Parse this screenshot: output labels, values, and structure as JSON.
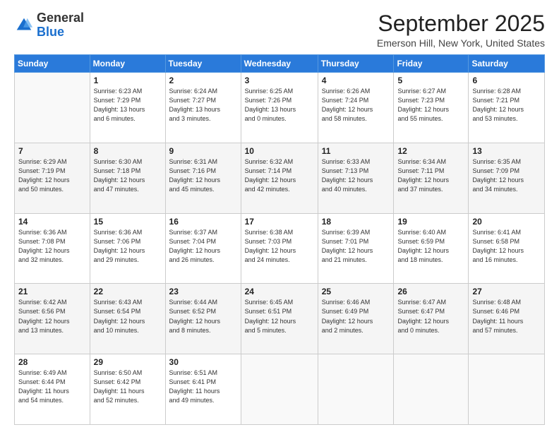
{
  "header": {
    "logo": {
      "general": "General",
      "blue": "Blue"
    },
    "title": "September 2025",
    "location": "Emerson Hill, New York, United States"
  },
  "days_of_week": [
    "Sunday",
    "Monday",
    "Tuesday",
    "Wednesday",
    "Thursday",
    "Friday",
    "Saturday"
  ],
  "weeks": [
    [
      {
        "day": "",
        "info": ""
      },
      {
        "day": "1",
        "info": "Sunrise: 6:23 AM\nSunset: 7:29 PM\nDaylight: 13 hours\nand 6 minutes."
      },
      {
        "day": "2",
        "info": "Sunrise: 6:24 AM\nSunset: 7:27 PM\nDaylight: 13 hours\nand 3 minutes."
      },
      {
        "day": "3",
        "info": "Sunrise: 6:25 AM\nSunset: 7:26 PM\nDaylight: 13 hours\nand 0 minutes."
      },
      {
        "day": "4",
        "info": "Sunrise: 6:26 AM\nSunset: 7:24 PM\nDaylight: 12 hours\nand 58 minutes."
      },
      {
        "day": "5",
        "info": "Sunrise: 6:27 AM\nSunset: 7:23 PM\nDaylight: 12 hours\nand 55 minutes."
      },
      {
        "day": "6",
        "info": "Sunrise: 6:28 AM\nSunset: 7:21 PM\nDaylight: 12 hours\nand 53 minutes."
      }
    ],
    [
      {
        "day": "7",
        "info": "Sunrise: 6:29 AM\nSunset: 7:19 PM\nDaylight: 12 hours\nand 50 minutes."
      },
      {
        "day": "8",
        "info": "Sunrise: 6:30 AM\nSunset: 7:18 PM\nDaylight: 12 hours\nand 47 minutes."
      },
      {
        "day": "9",
        "info": "Sunrise: 6:31 AM\nSunset: 7:16 PM\nDaylight: 12 hours\nand 45 minutes."
      },
      {
        "day": "10",
        "info": "Sunrise: 6:32 AM\nSunset: 7:14 PM\nDaylight: 12 hours\nand 42 minutes."
      },
      {
        "day": "11",
        "info": "Sunrise: 6:33 AM\nSunset: 7:13 PM\nDaylight: 12 hours\nand 40 minutes."
      },
      {
        "day": "12",
        "info": "Sunrise: 6:34 AM\nSunset: 7:11 PM\nDaylight: 12 hours\nand 37 minutes."
      },
      {
        "day": "13",
        "info": "Sunrise: 6:35 AM\nSunset: 7:09 PM\nDaylight: 12 hours\nand 34 minutes."
      }
    ],
    [
      {
        "day": "14",
        "info": "Sunrise: 6:36 AM\nSunset: 7:08 PM\nDaylight: 12 hours\nand 32 minutes."
      },
      {
        "day": "15",
        "info": "Sunrise: 6:36 AM\nSunset: 7:06 PM\nDaylight: 12 hours\nand 29 minutes."
      },
      {
        "day": "16",
        "info": "Sunrise: 6:37 AM\nSunset: 7:04 PM\nDaylight: 12 hours\nand 26 minutes."
      },
      {
        "day": "17",
        "info": "Sunrise: 6:38 AM\nSunset: 7:03 PM\nDaylight: 12 hours\nand 24 minutes."
      },
      {
        "day": "18",
        "info": "Sunrise: 6:39 AM\nSunset: 7:01 PM\nDaylight: 12 hours\nand 21 minutes."
      },
      {
        "day": "19",
        "info": "Sunrise: 6:40 AM\nSunset: 6:59 PM\nDaylight: 12 hours\nand 18 minutes."
      },
      {
        "day": "20",
        "info": "Sunrise: 6:41 AM\nSunset: 6:58 PM\nDaylight: 12 hours\nand 16 minutes."
      }
    ],
    [
      {
        "day": "21",
        "info": "Sunrise: 6:42 AM\nSunset: 6:56 PM\nDaylight: 12 hours\nand 13 minutes."
      },
      {
        "day": "22",
        "info": "Sunrise: 6:43 AM\nSunset: 6:54 PM\nDaylight: 12 hours\nand 10 minutes."
      },
      {
        "day": "23",
        "info": "Sunrise: 6:44 AM\nSunset: 6:52 PM\nDaylight: 12 hours\nand 8 minutes."
      },
      {
        "day": "24",
        "info": "Sunrise: 6:45 AM\nSunset: 6:51 PM\nDaylight: 12 hours\nand 5 minutes."
      },
      {
        "day": "25",
        "info": "Sunrise: 6:46 AM\nSunset: 6:49 PM\nDaylight: 12 hours\nand 2 minutes."
      },
      {
        "day": "26",
        "info": "Sunrise: 6:47 AM\nSunset: 6:47 PM\nDaylight: 12 hours\nand 0 minutes."
      },
      {
        "day": "27",
        "info": "Sunrise: 6:48 AM\nSunset: 6:46 PM\nDaylight: 11 hours\nand 57 minutes."
      }
    ],
    [
      {
        "day": "28",
        "info": "Sunrise: 6:49 AM\nSunset: 6:44 PM\nDaylight: 11 hours\nand 54 minutes."
      },
      {
        "day": "29",
        "info": "Sunrise: 6:50 AM\nSunset: 6:42 PM\nDaylight: 11 hours\nand 52 minutes."
      },
      {
        "day": "30",
        "info": "Sunrise: 6:51 AM\nSunset: 6:41 PM\nDaylight: 11 hours\nand 49 minutes."
      },
      {
        "day": "",
        "info": ""
      },
      {
        "day": "",
        "info": ""
      },
      {
        "day": "",
        "info": ""
      },
      {
        "day": "",
        "info": ""
      }
    ]
  ]
}
